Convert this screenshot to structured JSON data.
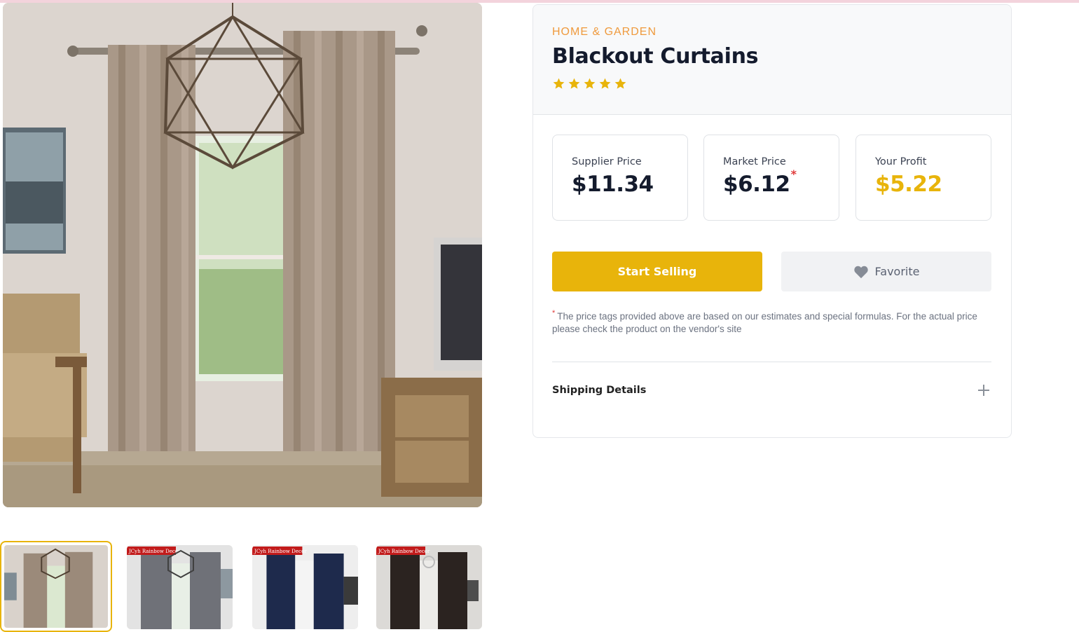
{
  "product": {
    "category": "HOME & GARDEN",
    "title": "Blackout Curtains",
    "rating": 5,
    "rating_max": 5,
    "image_alt": "main-product-image",
    "thumbnails": [
      {
        "label": "",
        "active": true,
        "tone": "#8f8275"
      },
      {
        "label": "JCyh Rainbow Decor",
        "active": false,
        "tone": "#6f7178"
      },
      {
        "label": "JCyh Rainbow Decor",
        "active": false,
        "tone": "#1e2a4c"
      },
      {
        "label": "JCyh Rainbow Decor",
        "active": false,
        "tone": "#2b2320"
      }
    ]
  },
  "prices": {
    "supplier": {
      "label": "Supplier Price",
      "value": "$11.34"
    },
    "market": {
      "label": "Market Price",
      "value": "$6.12",
      "asterisk": "*"
    },
    "profit": {
      "label": "Your Profit",
      "value": "$5.22"
    }
  },
  "actions": {
    "start_selling": "Start Selling",
    "favorite": "Favorite"
  },
  "note": {
    "asterisk": "*",
    "text": "The price tags provided above are based on our estimates and special formulas. For the actual price please check the product on the vendor's site"
  },
  "shipping": {
    "label": "Shipping Details"
  },
  "colors": {
    "accent": "#e8b40b",
    "category": "#ef9a3d",
    "asterisk": "#e03b3b",
    "title": "#141b2d"
  }
}
